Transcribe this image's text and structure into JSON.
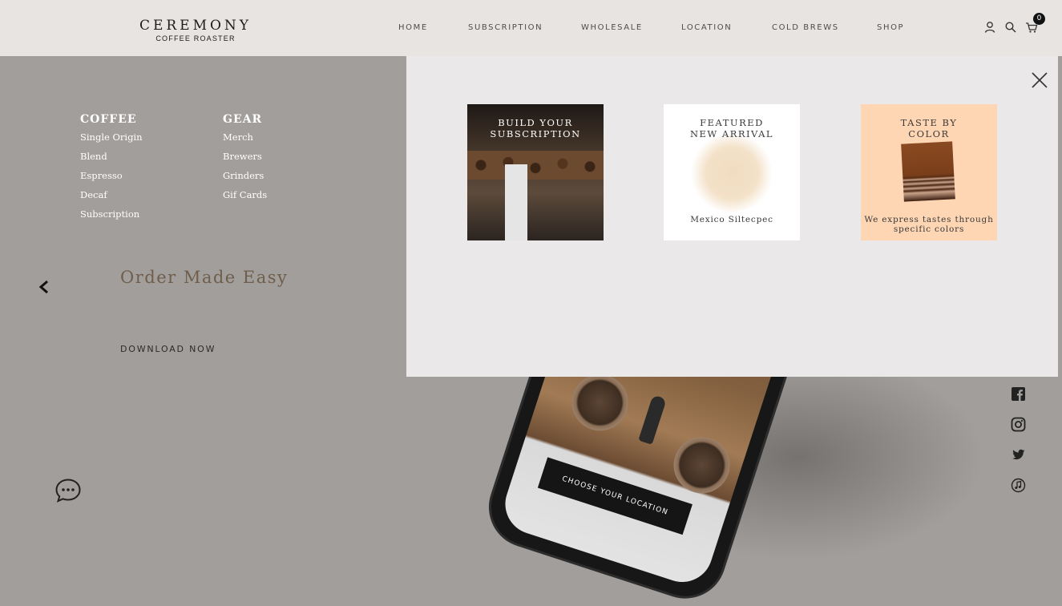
{
  "header": {
    "logo_name": "CEREMONY",
    "logo_sub": "COFFEE ROASTER",
    "nav": [
      {
        "label": "HOME"
      },
      {
        "label": "SUBSCRIPTION"
      },
      {
        "label": "WHOLESALE"
      },
      {
        "label": "LOCATION"
      },
      {
        "label": "COLD BREWS"
      },
      {
        "label": "SHOP"
      }
    ],
    "icons": [
      "account-icon",
      "search-icon",
      "cart-icon"
    ],
    "cart_count": "0"
  },
  "menu": {
    "coffee": {
      "heading": "COFFEE",
      "links": [
        "Single Origin",
        "Blend",
        "Espresso",
        "Decaf",
        "Subscription"
      ]
    },
    "gear": {
      "heading": "GEAR",
      "links": [
        "Merch",
        "Brewers",
        "Grinders",
        "Gif Cards"
      ]
    }
  },
  "promo": {
    "title": "Order Made Easy",
    "cta": "DOWNLOAD NOW",
    "phone_button": "CHOOSE YOUR LOCATION"
  },
  "cards": [
    {
      "title_line1": "BUILD YOUR",
      "title_line2": "SUBSCRIPTION",
      "sub": ""
    },
    {
      "title_line1": "FEATURED",
      "title_line2": "NEW ARRIVAL",
      "sub": "Mexico Siltecpec"
    },
    {
      "title_line1": "TASTE BY",
      "title_line2": "COLOR",
      "sub_line1": "We express tastes through",
      "sub_line2": "specific colors"
    }
  ],
  "social": [
    "facebook-icon",
    "instagram-icon",
    "twitter-icon",
    "music-icon"
  ],
  "colors": {
    "header_bg": "#e8e4e1",
    "page_bg": "#a29e9b",
    "overlay_bg": "#eae8e9",
    "promo_title": "#6f5e4c",
    "card3_bg": "#ffd6b3"
  }
}
